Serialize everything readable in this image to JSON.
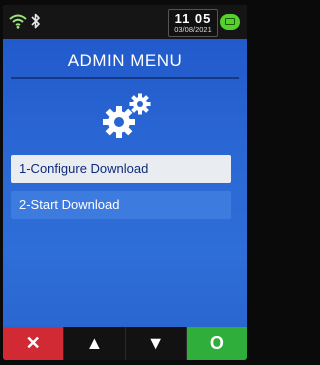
{
  "status": {
    "time": "11 05",
    "date": "03/08/2021",
    "wifi_icon": "wifi-icon",
    "bluetooth_icon": "bluetooth-icon",
    "battery_icon": "battery-icon",
    "battery_color": "#55d22a"
  },
  "header": {
    "title": "ADMIN MENU",
    "icon": "gears-icon"
  },
  "menu": {
    "items": [
      {
        "label": "1-Configure Download",
        "selected": true
      },
      {
        "label": "2-Start Download",
        "selected": false
      }
    ]
  },
  "softkeys": {
    "cancel": {
      "glyph": "✕",
      "color": "#d22a34"
    },
    "up": {
      "glyph": "▲"
    },
    "down": {
      "glyph": "▼"
    },
    "ok": {
      "glyph": "O",
      "color": "#2fae3b"
    }
  }
}
